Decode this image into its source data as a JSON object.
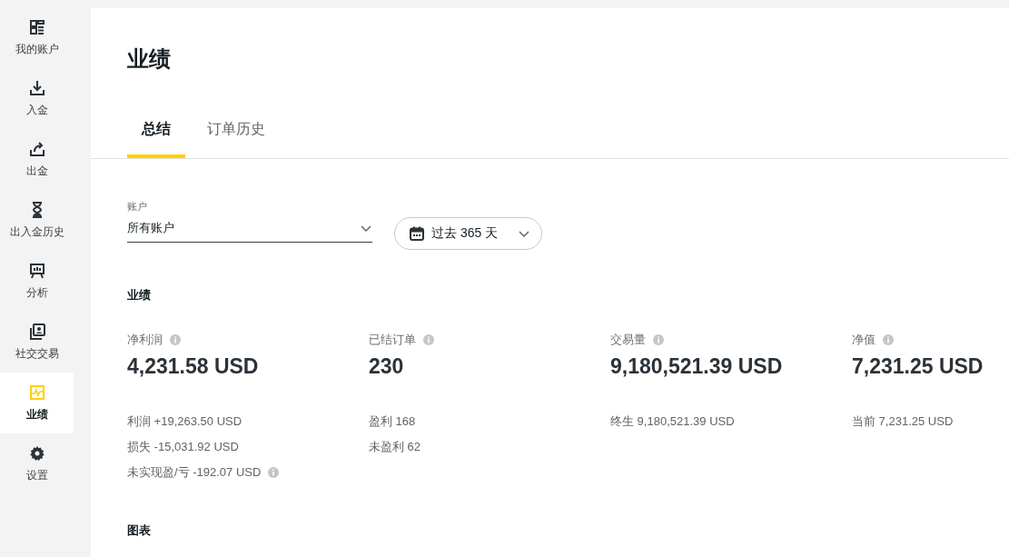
{
  "sidebar": {
    "items": [
      {
        "kind": "grid",
        "label": "我的账户",
        "selected": false
      },
      {
        "kind": "download",
        "label": "入金",
        "selected": false
      },
      {
        "kind": "upload",
        "label": "出金",
        "selected": false
      },
      {
        "kind": "hourglass",
        "label": "出入金历史",
        "selected": false
      },
      {
        "kind": "easel",
        "label": "分析",
        "selected": false
      },
      {
        "kind": "copy",
        "label": "社交交易",
        "selected": false
      },
      {
        "kind": "chart",
        "label": "业绩",
        "selected": true
      },
      {
        "kind": "gear",
        "label": "设置",
        "selected": false
      }
    ]
  },
  "page": {
    "title": "业绩"
  },
  "tabs": [
    {
      "label": "总结",
      "selected": true
    },
    {
      "label": "订单历史",
      "selected": false
    }
  ],
  "filters": {
    "account": {
      "label": "账户",
      "value": "所有账户"
    },
    "period": {
      "value": "过去 365 天"
    }
  },
  "performance": {
    "heading": "业绩",
    "stats": [
      {
        "label": "净利润",
        "value": "4,231.58 USD",
        "details": [
          {
            "kind": "plain",
            "text": "利润 +19,263.50 USD"
          },
          {
            "kind": "plain",
            "text": "损失 -15,031.92 USD"
          },
          {
            "kind": "with-info",
            "text": "未实现盈/亏 -192.07 USD"
          }
        ]
      },
      {
        "label": "已结订单",
        "value": "230",
        "details": [
          {
            "kind": "plain",
            "text": "盈利 168"
          },
          {
            "kind": "plain",
            "text": "未盈利 62"
          }
        ]
      },
      {
        "label": "交易量",
        "value": "9,180,521.39 USD",
        "details": [
          {
            "kind": "plain",
            "text": "终生 9,180,521.39 USD"
          }
        ]
      },
      {
        "label": "净值",
        "value": "7,231.25 USD",
        "details": [
          {
            "kind": "plain",
            "text": "当前 7,231.25 USD"
          }
        ]
      }
    ]
  },
  "charts": {
    "heading": "图表"
  }
}
